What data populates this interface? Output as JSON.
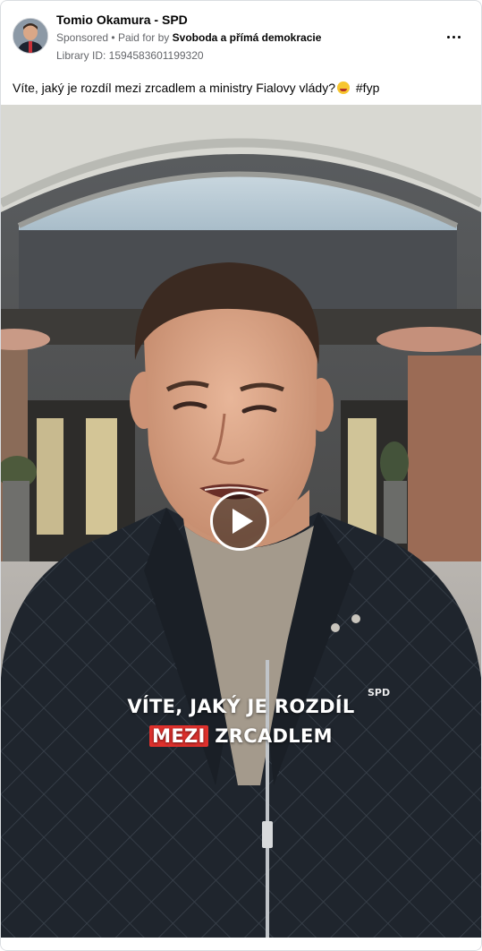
{
  "ad": {
    "page_name": "Tomio Okamura - SPD",
    "sponsored_label": "Sponsored",
    "separator": "•",
    "paid_for_prefix": "Paid for by",
    "payer": "Svoboda a přímá demokracie",
    "library_id": "Library ID: 1594583601199320",
    "caption": "Víte, jaký je rozdíl mezi zrcadlem a ministry Fialovy vlády?",
    "caption_emoji_icon": "grinning-sweat-emoji-icon",
    "hashtag": "#fyp",
    "more_icon": "more-horizontal-icon"
  },
  "video": {
    "overlay_line1": "VÍTE, JAKÝ JE ROZDÍL",
    "overlay_highlight": "MEZI",
    "overlay_rest": "ZRCADLEM",
    "highlight_color": "#e0312d",
    "play_icon": "play-icon"
  }
}
